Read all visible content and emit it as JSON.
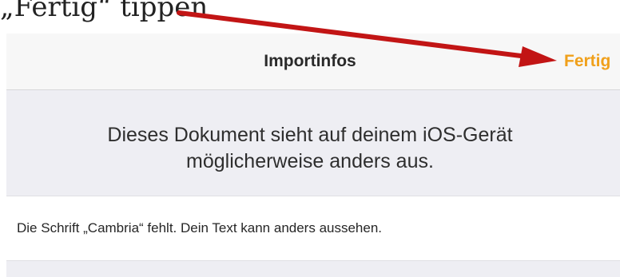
{
  "caption": {
    "text": "„Fertig“ tippen"
  },
  "navbar": {
    "title": "Importinfos",
    "done_label": "Fertig"
  },
  "warning": {
    "line1": "Dieses Dokument sieht auf deinem iOS-Gerät",
    "line2": "möglicherweise anders aus."
  },
  "info": {
    "font_missing": "Die Schrift „Cambria“ fehlt. Dein Text kann anders aussehen."
  },
  "colors": {
    "accent": "#f0a01b",
    "annotation_arrow": "#c21515",
    "navbar_bg": "#f7f7f7",
    "group_bg": "#eeeef3"
  },
  "annotation": {
    "arrow_icon": "red-arrow-pointing-to-done-button"
  }
}
